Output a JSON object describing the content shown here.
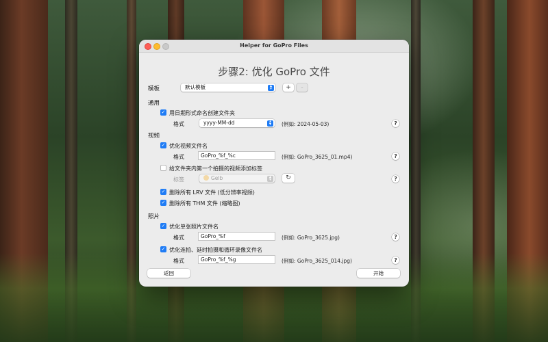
{
  "window": {
    "title": "Helper for GoPro Files"
  },
  "heading": "步骤2: 优化 GoPro 文件",
  "template": {
    "label": "模板",
    "selected": "默认模板",
    "add": "+",
    "remove": "-"
  },
  "general": {
    "section": "通用",
    "create_folders": {
      "label": "用日期形式命名创建文件夹",
      "checked": true
    },
    "format_label": "格式",
    "format_value": "yyyy-MM-dd",
    "example": "(例如: 2024-05-03)",
    "help": "?"
  },
  "video": {
    "section": "视频",
    "optimize_names": {
      "label": "优化视频文件名",
      "checked": true
    },
    "format_label": "格式",
    "format_value": "GoPro_%f_%c",
    "example": "(例如: GoPro_3625_01.mp4)",
    "help": "?",
    "tag_first": {
      "label": "给文件夹内第一个拍摄的视频添加标签",
      "checked": false
    },
    "tag_label": "标签",
    "tag_value": "Gelb",
    "refresh_icon": "↻",
    "tag_help": "?",
    "delete_lrv": {
      "label": "删除所有 LRV 文件 (低分辨率视频)",
      "checked": true
    },
    "delete_thm": {
      "label": "删除所有 THM 文件 (缩略图)",
      "checked": true
    }
  },
  "photo": {
    "section": "照片",
    "optimize_single": {
      "label": "优化单张照片文件名",
      "checked": true
    },
    "single_format_label": "格式",
    "single_format_value": "GoPro_%f",
    "single_example": "(例如: GoPro_3625.jpg)",
    "single_help": "?",
    "optimize_burst": {
      "label": "优化连拍、延时拍摄和循环录像文件名",
      "checked": true
    },
    "burst_format_label": "格式",
    "burst_format_value": "GoPro_%f_%g",
    "burst_example": "(例如: GoPro_3625_014.jpg)",
    "burst_help": "?"
  },
  "footer": {
    "back": "返回",
    "start": "开始"
  },
  "colors": {
    "accent": "#1f7cf5",
    "window_bg": "#ececec",
    "close": "#fe5f57",
    "minimize": "#febc2e",
    "tag_color": "#f3d9a7"
  }
}
